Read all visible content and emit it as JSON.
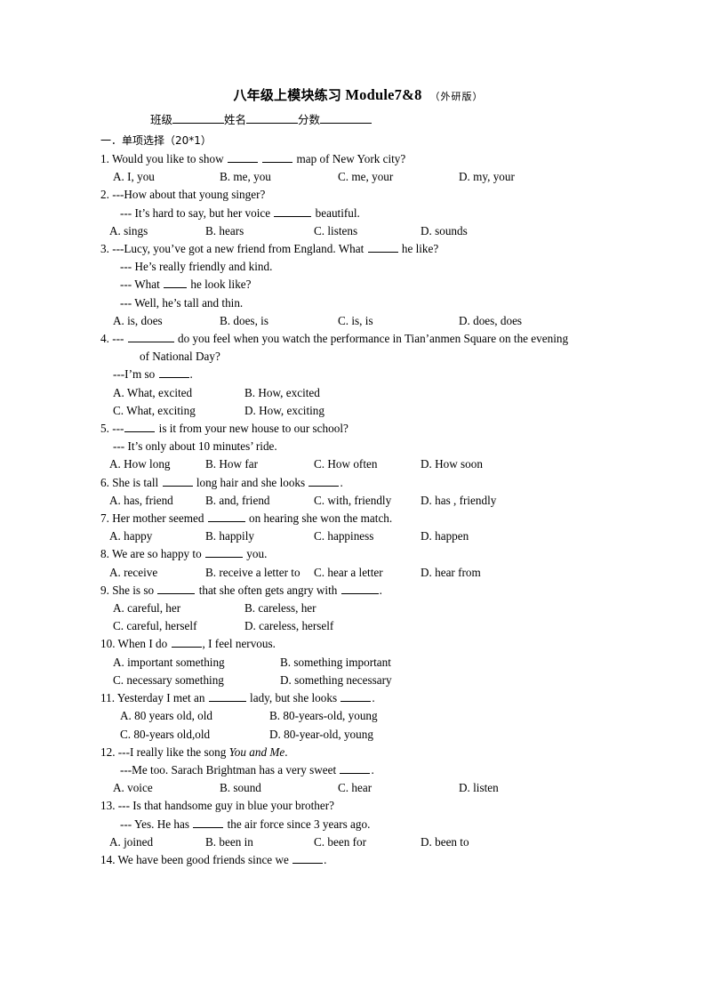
{
  "document": {
    "title_cn": "八年级上模块练习",
    "title_module": "Module7&8",
    "title_publisher": "（外研版）",
    "info_class": "班级",
    "info_name": "姓名",
    "info_score": "分数",
    "section_heading": "一．单项选择（20*1）"
  },
  "questions": [
    {
      "id": "q1",
      "lines": [
        {
          "indent": 0,
          "parts": [
            "1. Would you like to show ",
            "__b-m__",
            " ",
            "__b-m__",
            " map of New York city?"
          ]
        }
      ],
      "options": {
        "layout": "cols-4",
        "items": [
          "A. I, you",
          "B. me, you",
          "C. me, your",
          "D. my, your"
        ]
      }
    },
    {
      "id": "q2",
      "lines": [
        {
          "indent": 0,
          "parts": [
            "2.   ---How about that young singer?"
          ]
        },
        {
          "indent": 2,
          "parts": [
            "--- It’s hard to say, but her voice ",
            "__b-l__",
            " beautiful."
          ]
        }
      ],
      "options": {
        "layout": "cols-4b",
        "items": [
          "A. sings",
          "B. hears",
          "C. listens",
          "D.   sounds"
        ]
      }
    },
    {
      "id": "q3",
      "lines": [
        {
          "indent": 0,
          "parts": [
            "3.   ---Lucy, you’ve got a new friend from England. What ",
            "__b-m__",
            " he like?"
          ]
        },
        {
          "indent": 2,
          "parts": [
            "--- He’s really friendly and kind."
          ]
        },
        {
          "indent": 2,
          "parts": [
            "--- What ",
            "__b-s__",
            " he look like?"
          ]
        },
        {
          "indent": 2,
          "parts": [
            "--- Well, he’s tall and thin."
          ]
        }
      ],
      "options": {
        "layout": "cols-4",
        "items": [
          "A. is, does",
          "B. does, is",
          "C. is, is",
          "D. does, does"
        ]
      }
    },
    {
      "id": "q4",
      "lines": [
        {
          "indent": 0,
          "wrap": true,
          "parts": [
            "4. --- ",
            "__b-xl__",
            " do you feel when you watch the performance in Tian’anmen Square on the evening"
          ]
        },
        {
          "indent": 4,
          "parts": [
            "of National Day?"
          ]
        },
        {
          "indent": 1,
          "parts": [
            "---I’m so ",
            "__b-m__",
            "."
          ]
        }
      ],
      "options_stacked": [
        {
          "layout": "cols-2",
          "items": [
            "A. What, excited",
            "B. How, excited"
          ]
        },
        {
          "layout": "cols-2",
          "items": [
            "C. What, exciting",
            "D. How, exciting"
          ]
        }
      ]
    },
    {
      "id": "q5",
      "lines": [
        {
          "indent": 0,
          "parts": [
            "5. ---",
            "__b-m__",
            " is it from your new house to our school?"
          ]
        },
        {
          "indent": 1,
          "parts": [
            "--- It’s only about 10 minutes’ ride."
          ]
        }
      ],
      "options": {
        "layout": "cols-4b",
        "items": [
          "A. How long",
          "B. How far",
          "C. How often",
          "D. How soon"
        ]
      }
    },
    {
      "id": "q6",
      "lines": [
        {
          "indent": 0,
          "parts": [
            "6. She is tall ",
            "__b-m__",
            " long hair and she looks ",
            "__b-m__",
            "."
          ]
        }
      ],
      "options": {
        "layout": "cols-4b",
        "items": [
          "A. has, friend",
          "B. and, friend",
          "C. with, friendly",
          "D. has , friendly"
        ]
      }
    },
    {
      "id": "q7",
      "lines": [
        {
          "indent": 0,
          "parts": [
            "7. Her mother seemed ",
            "__b-l__",
            " on hearing she won the match."
          ]
        }
      ],
      "options": {
        "layout": "cols-4b",
        "items": [
          "A. happy",
          "B. happily",
          "C. happiness",
          "D. happen"
        ]
      }
    },
    {
      "id": "q8",
      "lines": [
        {
          "indent": 0,
          "parts": [
            "8. We are so happy to ",
            "__b-l__",
            " you."
          ]
        }
      ],
      "options": {
        "layout": "cols-4b",
        "items": [
          "A. receive",
          "B. receive a letter to",
          "C. hear a letter",
          "D. hear from"
        ]
      }
    },
    {
      "id": "q9",
      "lines": [
        {
          "indent": 0,
          "parts": [
            "9. She is so ",
            "__b-l__",
            " that she often gets angry with ",
            "__b-l__",
            "."
          ]
        }
      ],
      "options_stacked": [
        {
          "layout": "cols-2",
          "items": [
            "A. careful, her",
            "B. careless, her"
          ]
        },
        {
          "layout": "cols-2",
          "items": [
            "C. careful, herself",
            "D. careless, herself"
          ]
        }
      ]
    },
    {
      "id": "q10",
      "lines": [
        {
          "indent": 0,
          "parts": [
            "10. When I do ",
            "__b-m__",
            ", I feel nervous."
          ]
        }
      ],
      "options_stacked": [
        {
          "layout": "cols-2w",
          "items": [
            "A. important something",
            "B. something important"
          ]
        },
        {
          "layout": "cols-2w",
          "items": [
            "C. necessary something",
            "D. something necessary"
          ]
        }
      ]
    },
    {
      "id": "q11",
      "lines": [
        {
          "indent": 0,
          "parts": [
            "11. Yesterday I met an ",
            "__b-l__",
            " lady, but she looks ",
            "__b-m__",
            "."
          ]
        }
      ],
      "options_stacked": [
        {
          "layout": "cols-2x",
          "items": [
            "A. 80 years old, old",
            "B. 80-years-old, young"
          ]
        },
        {
          "layout": "cols-2x",
          "items": [
            "C. 80-years old,old",
            "D. 80-year-old, young"
          ]
        }
      ]
    },
    {
      "id": "q12",
      "lines": [
        {
          "indent": 0,
          "parts": [
            "12. ---I really like the song ",
            "__it:You and Me__",
            "."
          ]
        },
        {
          "indent": 2,
          "parts": [
            "---Me too. Sarach Brightman has a very sweet ",
            "__b-m__",
            "."
          ]
        }
      ],
      "options": {
        "layout": "cols-4",
        "items": [
          "A. voice",
          "B. sound",
          "C. hear",
          "D. listen"
        ]
      }
    },
    {
      "id": "q13",
      "lines": [
        {
          "indent": 0,
          "parts": [
            "13. --- Is that handsome guy in blue your brother?"
          ]
        },
        {
          "indent": 2,
          "parts": [
            "--- Yes. He has ",
            "__b-m__",
            " the air force since 3 years ago."
          ]
        }
      ],
      "options": {
        "layout": "cols-4b",
        "items": [
          "A. joined",
          "B. been in",
          "C. been for",
          "D. been to"
        ]
      }
    },
    {
      "id": "q14",
      "lines": [
        {
          "indent": 0,
          "parts": [
            "14. We have been good friends since we ",
            "__b-m__",
            "."
          ]
        }
      ]
    }
  ]
}
